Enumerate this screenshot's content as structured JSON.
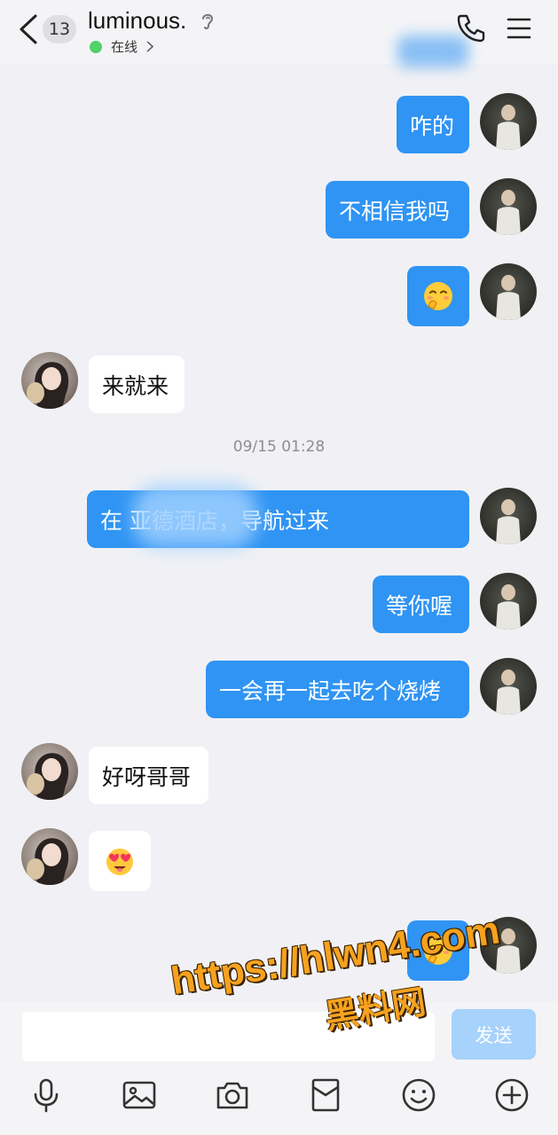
{
  "header": {
    "unread_count": "13",
    "contact_name": "luminous.",
    "status": "在线"
  },
  "messages": [
    {
      "side": "out",
      "text": "咋的"
    },
    {
      "side": "out",
      "text": "不相信我吗"
    },
    {
      "side": "out",
      "emoji": "shy-face-emoji"
    },
    {
      "side": "in",
      "text": "来就来"
    },
    {
      "side": "out",
      "text": "在    亚德酒店，导航过来"
    },
    {
      "side": "out",
      "text": "等你喔"
    },
    {
      "side": "out",
      "text": "一会再一起去吃个烧烤"
    },
    {
      "side": "in",
      "text": "好呀哥哥"
    },
    {
      "side": "in",
      "emoji": "heart-eyes-emoji"
    },
    {
      "side": "out",
      "emoji": "shy-face-emoji"
    }
  ],
  "timestamp": "09/15 01:28",
  "composer": {
    "input_value": "",
    "send_label": "发送"
  },
  "toolbar_icons": [
    "microphone-icon",
    "image-icon",
    "camera-icon",
    "red-packet-icon",
    "smiley-icon",
    "plus-icon"
  ],
  "watermark": {
    "url": "https://hlwn4.com",
    "name": "黑料网"
  },
  "colors": {
    "outgoing_bubble": "#2f94f3",
    "incoming_bubble": "#ffffff",
    "background": "#f1f1f5",
    "online_dot": "#52d26a",
    "send_button": "#a7d2fb"
  }
}
